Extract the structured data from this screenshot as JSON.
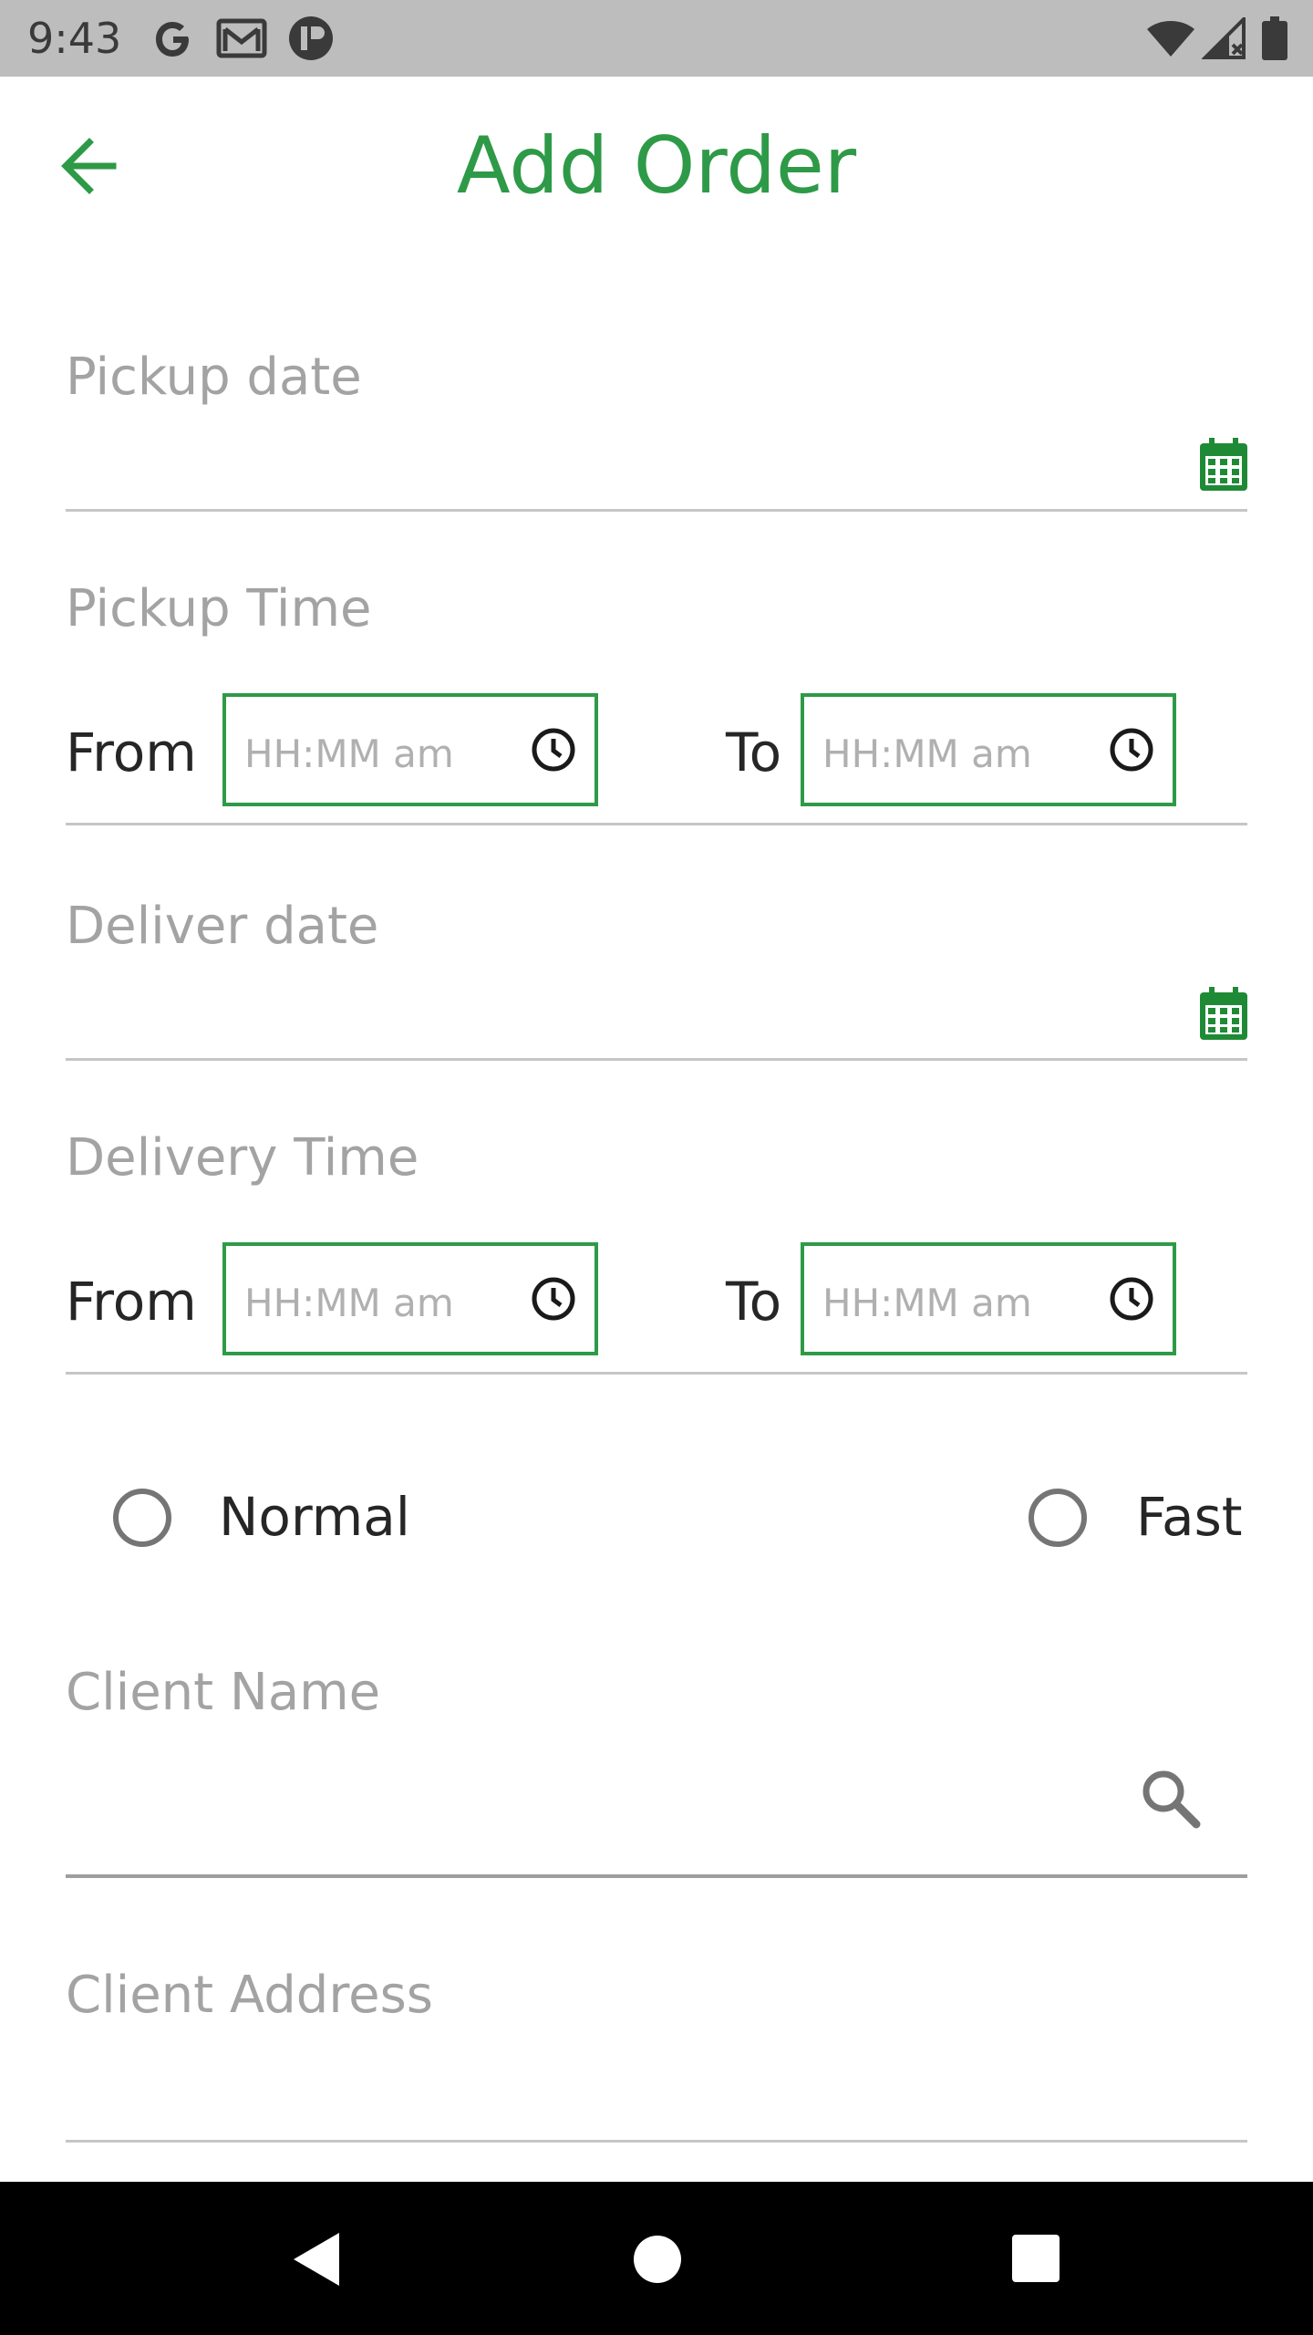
{
  "status_bar": {
    "time": "9:43",
    "left_icons": [
      "google-g-icon",
      "gmail-icon",
      "app-notification-icon"
    ],
    "right_icons": [
      "wifi-icon",
      "cellular-signal-icon",
      "battery-icon"
    ]
  },
  "app_bar": {
    "title": "Add Order",
    "back_icon": "arrow-left-icon"
  },
  "form": {
    "pickup_date": {
      "label": "Pickup date",
      "value": "",
      "icon": "calendar-icon"
    },
    "pickup_time": {
      "label": "Pickup Time",
      "from_label": "From",
      "from_placeholder": "HH:MM am",
      "to_label": "To",
      "to_placeholder": "HH:MM am"
    },
    "deliver_date": {
      "label": "Deliver date",
      "value": "",
      "icon": "calendar-icon"
    },
    "delivery_time": {
      "label": "Delivery Time",
      "from_label": "From",
      "from_placeholder": "HH:MM am",
      "to_label": "To",
      "to_placeholder": "HH:MM am"
    },
    "speed_options": [
      {
        "label": "Normal",
        "selected": false
      },
      {
        "label": "Fast",
        "selected": false
      }
    ],
    "client_name": {
      "label": "Client Name",
      "value": "",
      "icon": "search-icon"
    },
    "client_address": {
      "label": "Client Address",
      "value": ""
    }
  },
  "colors": {
    "accent": "#2e9a47",
    "calendar_icon": "#1f8a36",
    "status_bar": "#bdbdbd",
    "label_gray": "#a3a3a3",
    "nav_bar": "#000000"
  },
  "nav_bar": {
    "buttons": [
      "back-triangle-icon",
      "home-circle-icon",
      "recents-square-icon"
    ]
  }
}
